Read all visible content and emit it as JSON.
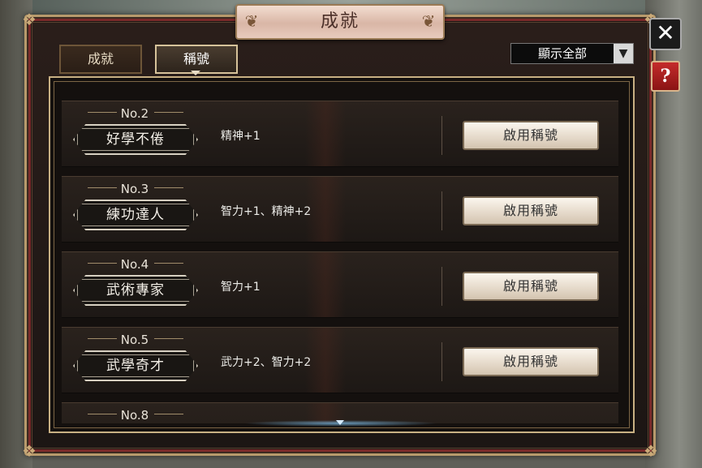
{
  "title": "成就",
  "tabs": [
    {
      "label": "成就",
      "active": false
    },
    {
      "label": "稱號",
      "active": true
    }
  ],
  "filter": {
    "selected": "顯示全部"
  },
  "close_label": "✕",
  "help_label": "?",
  "rows": [
    {
      "rank": "No.2",
      "name": "好學不倦",
      "effect": "精神+1",
      "button": "啟用稱號"
    },
    {
      "rank": "No.3",
      "name": "練功達人",
      "effect": "智力+1、精神+2",
      "button": "啟用稱號"
    },
    {
      "rank": "No.4",
      "name": "武術專家",
      "effect": "智力+1",
      "button": "啟用稱號"
    },
    {
      "rank": "No.5",
      "name": "武學奇才",
      "effect": "武力+2、智力+2",
      "button": "啟用稱號"
    },
    {
      "rank": "No.8",
      "name": "",
      "effect": "",
      "button": ""
    }
  ]
}
